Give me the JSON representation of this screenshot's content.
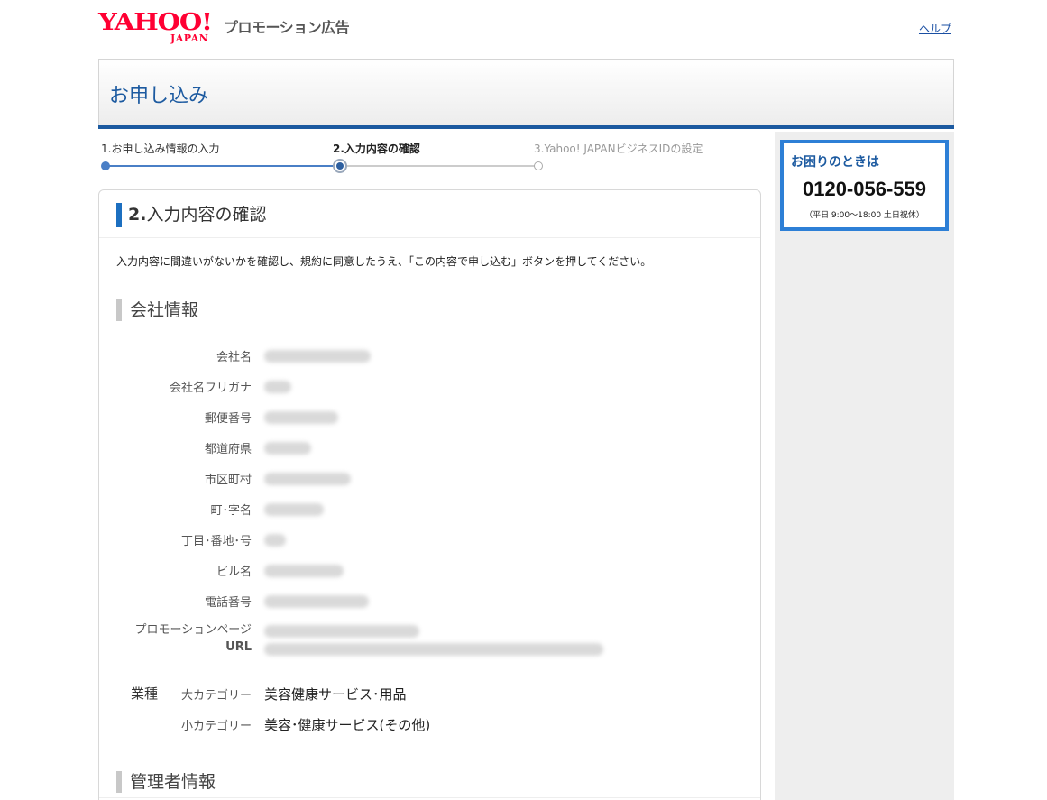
{
  "header": {
    "logo_text": "YAHOO!",
    "logo_sub": "JAPAN",
    "service_name": "プロモーション広告",
    "help_link": "ヘルプ"
  },
  "page": {
    "title": "お申し込み"
  },
  "steps": [
    {
      "label": "1.お申し込み情報の入力",
      "state": "done"
    },
    {
      "label": "2.入力内容の確認",
      "state": "current"
    },
    {
      "label": "3.Yahoo! JAPANビジネスIDの設定",
      "state": "todo"
    }
  ],
  "main": {
    "section_number": "2.",
    "section_title": "入力内容の確認",
    "intro": "入力内容に間違いがないかを確認し、規約に同意したうえ、「この内容で申し込む」ボタンを押してください。",
    "company_heading": "会社情報",
    "fields": [
      {
        "label": "会社名"
      },
      {
        "label": "会社名フリガナ"
      },
      {
        "label": "郵便番号"
      },
      {
        "label": "都道府県"
      },
      {
        "label": "市区町村"
      },
      {
        "label": "町･字名"
      },
      {
        "label": "丁目･番地･号"
      },
      {
        "label": "ビル名"
      },
      {
        "label": "電話番号"
      },
      {
        "label_line1": "プロモーションページ",
        "label_line2": "URL"
      }
    ],
    "industry": {
      "label": "業種",
      "major_label": "大カテゴリー",
      "major_value": "美容健康サービス･用品",
      "minor_label": "小カテゴリー",
      "minor_value": "美容･健康サービス(その他)"
    },
    "admin_heading": "管理者情報"
  },
  "sidebar": {
    "help_title": "お困りのときは",
    "phone": "0120-056-559",
    "hours": "（平日 9:00〜18:00 土日祝休）"
  },
  "colors": {
    "brand_red": "#ff0033",
    "accent_blue": "#1c5aa0",
    "help_border": "#2d7fd6"
  }
}
